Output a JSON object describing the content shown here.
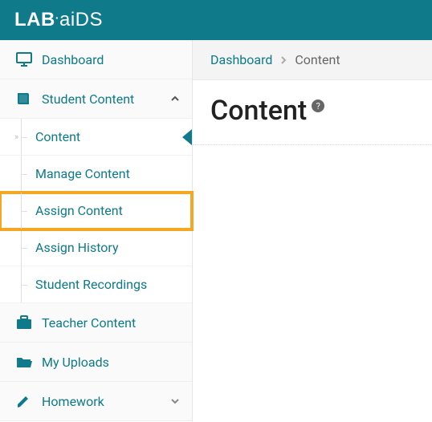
{
  "brand": {
    "part1": "LAB",
    "dot": "·",
    "part2": "aiDS"
  },
  "sidebar": {
    "items": [
      {
        "label": "Dashboard",
        "icon": "monitor"
      },
      {
        "label": "Student Content",
        "icon": "book",
        "expanded": true,
        "children": [
          {
            "label": "Content",
            "active": true
          },
          {
            "label": "Manage Content"
          },
          {
            "label": "Assign Content",
            "highlight": true
          },
          {
            "label": "Assign History"
          },
          {
            "label": "Student Recordings"
          }
        ]
      },
      {
        "label": "Teacher Content",
        "icon": "briefcase"
      },
      {
        "label": "My Uploads",
        "icon": "folder-open"
      },
      {
        "label": "Homework",
        "icon": "pencil",
        "collapsed": true
      }
    ]
  },
  "breadcrumb": {
    "root": "Dashboard",
    "current": "Content"
  },
  "page": {
    "title": "Content",
    "help": "?"
  }
}
